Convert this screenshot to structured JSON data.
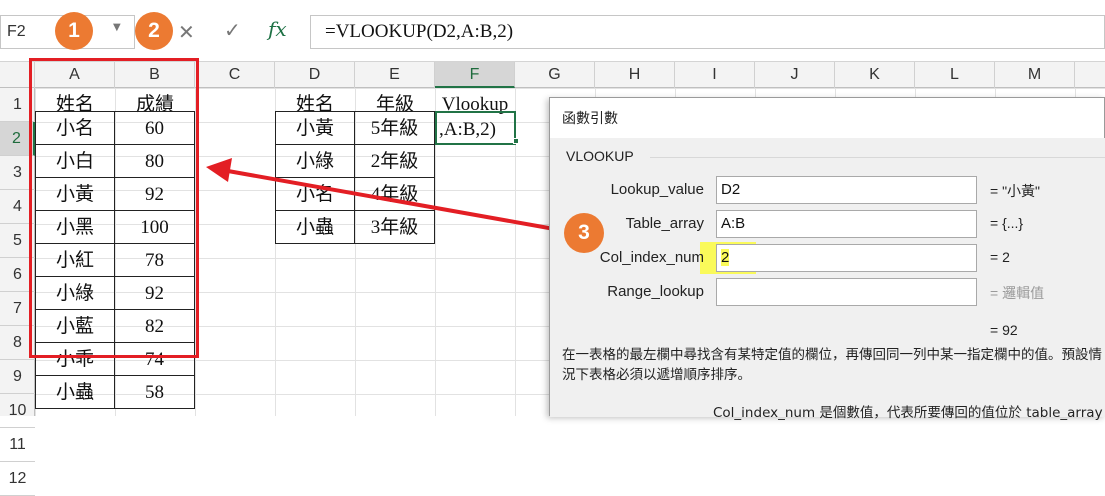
{
  "formula_bar": {
    "name_box": "F2",
    "cancel_icon": "✕",
    "enter_icon": "✓",
    "fx_label": "fx",
    "formula": "=VLOOKUP(D2,A:B,2)"
  },
  "columns": [
    "A",
    "B",
    "C",
    "D",
    "E",
    "F",
    "G",
    "H",
    "I",
    "J",
    "K",
    "L",
    "M"
  ],
  "rows": [
    "1",
    "2",
    "3",
    "4",
    "5",
    "6",
    "7",
    "8",
    "9",
    "10",
    "11",
    "12"
  ],
  "sheet": {
    "table1": {
      "header": [
        "姓名",
        "成績"
      ],
      "rows": [
        [
          "小名",
          "60"
        ],
        [
          "小白",
          "80"
        ],
        [
          "小黃",
          "92"
        ],
        [
          "小黑",
          "100"
        ],
        [
          "小紅",
          "78"
        ],
        [
          "小綠",
          "92"
        ],
        [
          "小藍",
          "82"
        ],
        [
          "小乖",
          "74"
        ],
        [
          "小蟲",
          "58"
        ]
      ]
    },
    "table2": {
      "header": [
        "姓名",
        "年級"
      ],
      "rows": [
        [
          "小黃",
          "5年級"
        ],
        [
          "小綠",
          "2年級"
        ],
        [
          "小名",
          "4年級"
        ],
        [
          "小蟲",
          "3年級"
        ]
      ]
    },
    "f1": "Vlookup",
    "f2_editing": ",A:B,2)"
  },
  "steps": [
    "1",
    "2",
    "3"
  ],
  "dialog": {
    "title": "函數引數",
    "function_name": "VLOOKUP",
    "args": [
      {
        "label": "Lookup_value",
        "value": "D2",
        "result": "= \"小黃\"",
        "muted": false
      },
      {
        "label": "Table_array",
        "value": "A:B",
        "result": "= {...}",
        "muted": false
      },
      {
        "label": "Col_index_num",
        "value": "2",
        "result": "= 2",
        "muted": false
      },
      {
        "label": "Range_lookup",
        "value": "",
        "result": "= 邏輯值",
        "muted": true
      }
    ],
    "collapse_icon": "⬆",
    "result": "= 92",
    "description": "在一表格的最左欄中尋找含有某特定值的欄位，再傳回同一列中某一指定欄中的值。預設情況下表格必須以遞增順序排序。",
    "param_description": "Col_index_num  是個數值，代表所要傳回的值位於 table_array"
  },
  "colors": {
    "accent": "#217346",
    "highlight_red": "#e31e24",
    "step_orange": "#ec7a32",
    "yellow": "#fafa5a"
  }
}
